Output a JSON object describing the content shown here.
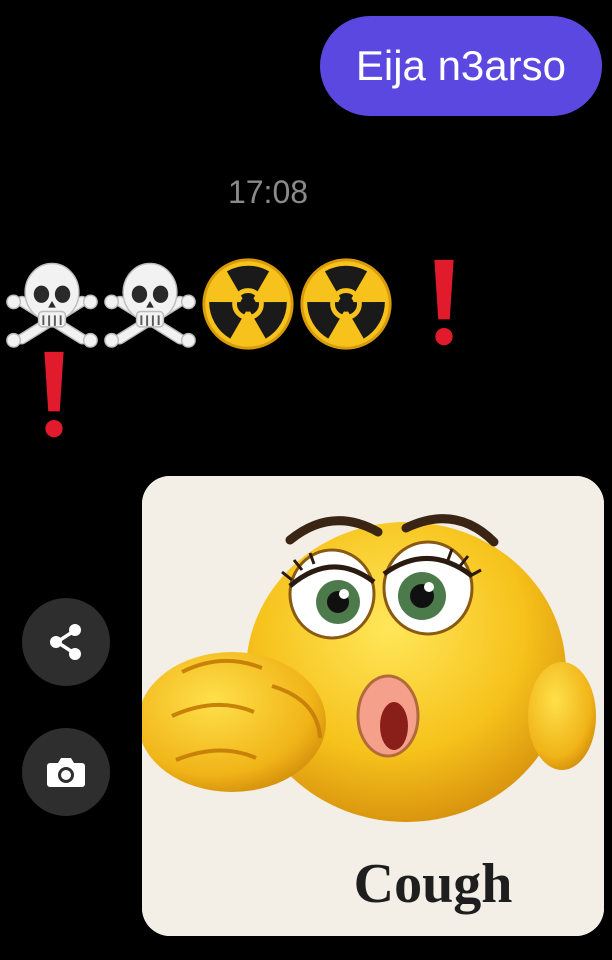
{
  "chat": {
    "sent_message": {
      "text": "Eija n3arso",
      "bubble_color": "#5a48e0"
    },
    "timestamp": "17:08",
    "received_emoji_message": {
      "emojis": [
        "skull-and-crossbones",
        "skull-and-crossbones",
        "radioactive",
        "radioactive",
        "exclamation-mark",
        "exclamation-mark"
      ]
    },
    "image_message": {
      "subject": "coughing-emoji",
      "caption": "Cough"
    },
    "actions": [
      {
        "icon": "share-icon"
      },
      {
        "icon": "camera-icon"
      }
    ]
  },
  "colors": {
    "background": "#000000",
    "timestamp": "#8a8a8a",
    "action_button": "#2e2e2e"
  }
}
